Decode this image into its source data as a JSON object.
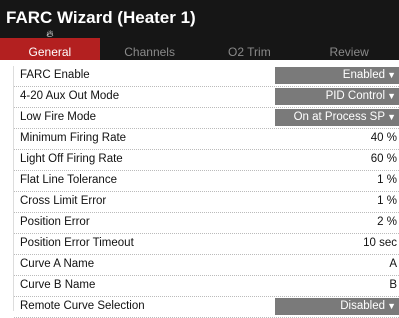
{
  "header": {
    "title": "FARC Wizard (Heater 1)"
  },
  "tabs": [
    {
      "label": "General",
      "active": true
    },
    {
      "label": "Channels",
      "active": false
    },
    {
      "label": "O2 Trim",
      "active": false
    },
    {
      "label": "Review",
      "active": false
    }
  ],
  "rows": [
    {
      "label": "FARC Enable",
      "value": "Enabled",
      "type": "select"
    },
    {
      "label": "4-20 Aux Out Mode",
      "value": "PID Control",
      "type": "select"
    },
    {
      "label": "Low Fire Mode",
      "value": "On at Process SP",
      "type": "select"
    },
    {
      "label": "Minimum Firing Rate",
      "value": "40 %",
      "type": "value"
    },
    {
      "label": "Light Off Firing Rate",
      "value": "60 %",
      "type": "value"
    },
    {
      "label": "Flat Line Tolerance",
      "value": "1 %",
      "type": "value"
    },
    {
      "label": "Cross Limit Error",
      "value": "1 %",
      "type": "value"
    },
    {
      "label": "Position Error",
      "value": "2 %",
      "type": "value"
    },
    {
      "label": "Position Error Timeout",
      "value": "10 sec",
      "type": "value"
    },
    {
      "label": "Curve A Name",
      "value": "A",
      "type": "value"
    },
    {
      "label": "Curve B Name",
      "value": "B",
      "type": "value"
    },
    {
      "label": "Remote Curve Selection",
      "value": "Disabled",
      "type": "select"
    }
  ],
  "colors": {
    "header_bg": "#161616",
    "active_tab": "#b32020",
    "select_bg": "#7a7a7a"
  },
  "icons": {
    "active_tab_icon": "flame-icon",
    "dropdown": "caret-down-icon"
  }
}
